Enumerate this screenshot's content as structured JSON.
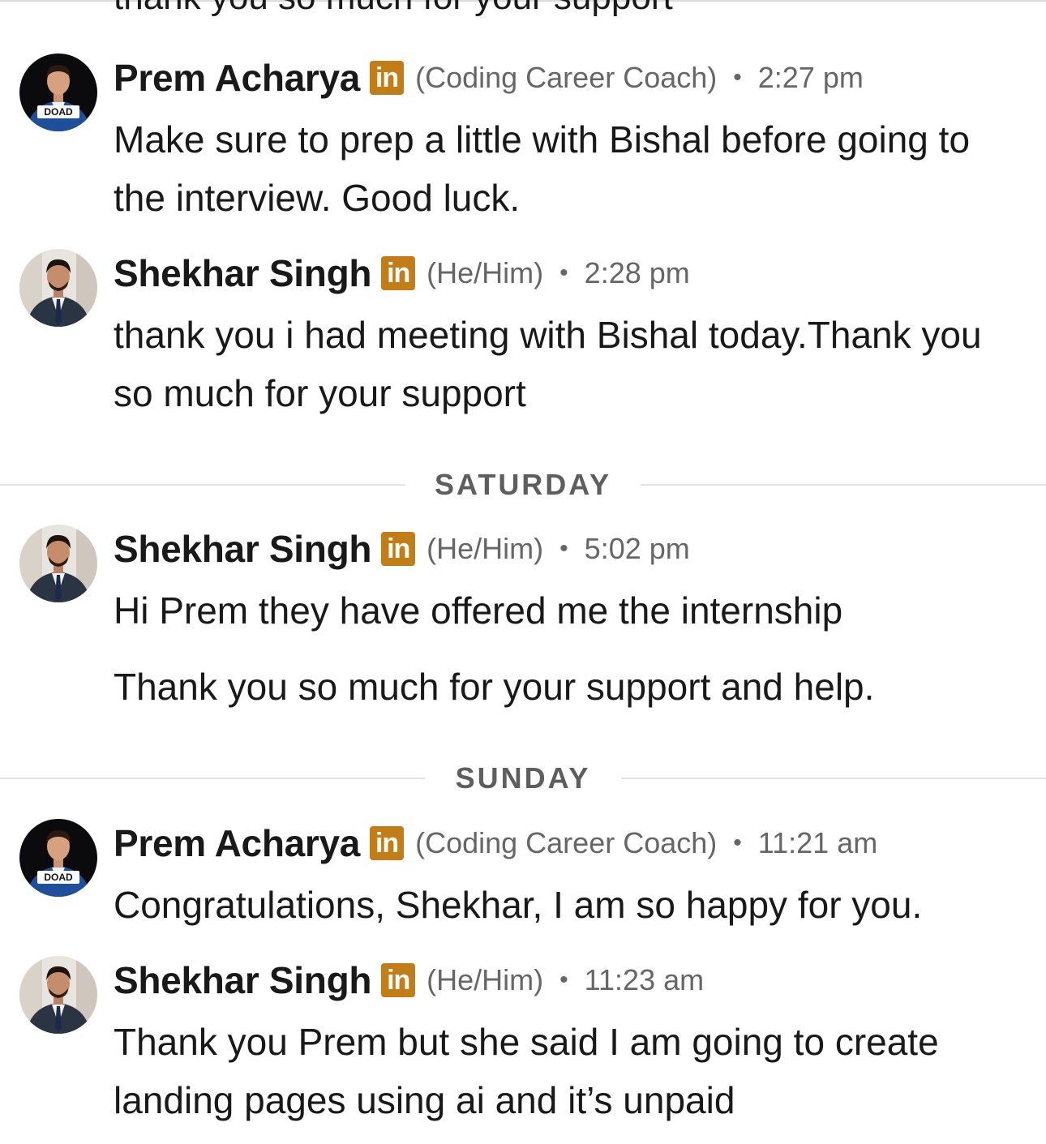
{
  "previous_message_fragment": "thank you so much for your support",
  "participants": {
    "prem": {
      "name": "Prem Acharya",
      "headline": "(Coding Career Coach)",
      "avatar_badge": "DOAD"
    },
    "shekhar": {
      "name": "Shekhar Singh",
      "headline": "(He/Him)"
    }
  },
  "linkedin_badge": {
    "text": "in",
    "color": "#c37d16"
  },
  "separator_dot": "•",
  "messages": [
    {
      "time": "2:27 pm",
      "lines": [
        "Make sure to prep a little with Bishal before going to the interview. Good luck."
      ]
    },
    {
      "time": "2:28 pm",
      "lines": [
        "thank you i had meeting with Bishal today.Thank you so much for your support"
      ]
    },
    {
      "time": "5:02 pm",
      "lines": [
        "Hi Prem they have offered me the internship",
        "Thank you so much for your support and help."
      ]
    },
    {
      "time": "11:21 am",
      "lines": [
        "Congratulations, Shekhar, I am so happy for you."
      ]
    },
    {
      "time": "11:23 am",
      "lines": [
        "Thank you Prem but she said I am going to create landing pages using ai and it’s unpaid"
      ]
    }
  ],
  "day_dividers": [
    "SATURDAY",
    "SUNDAY"
  ]
}
